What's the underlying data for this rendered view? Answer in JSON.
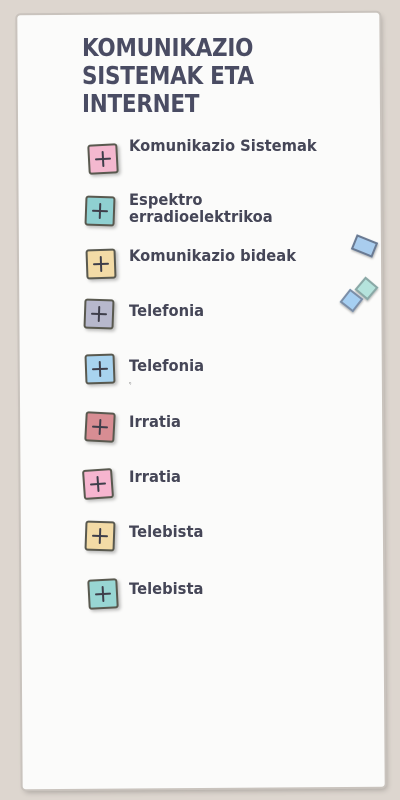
{
  "title": "KOMUNIKAZIO SISTEMAK ETA INTERNET",
  "colors": {
    "paper": "#fbfbfa",
    "background": "#ddd6cf",
    "text": "#454657"
  },
  "menu": [
    {
      "label": "Komunikazio Sistemak",
      "icon": "plus-icon",
      "color": "#f4b8cf"
    },
    {
      "label": "Espektro\nerradioelektrikoa",
      "icon": "plus-icon",
      "color": "#8fd0d1"
    },
    {
      "label": "Komunikazio bideak",
      "icon": "plus-icon",
      "color": "#f3dba6"
    },
    {
      "label": "Telefonia",
      "icon": "plus-icon",
      "color": "#b7b8cc"
    },
    {
      "label": "Telefonia",
      "sub": "ᵑ",
      "icon": "plus-icon",
      "color": "#a8d3ef"
    },
    {
      "label": "Irratia",
      "icon": "plus-icon",
      "color": "#d88d93"
    },
    {
      "label": " Irratia",
      "icon": "plus-icon",
      "color": "#f6b5cf"
    },
    {
      "label": "Telebista",
      "icon": "plus-icon",
      "color": "#f3dba6"
    },
    {
      "label": "Telebista",
      "icon": "plus-icon",
      "color": "#98d6d3"
    }
  ]
}
